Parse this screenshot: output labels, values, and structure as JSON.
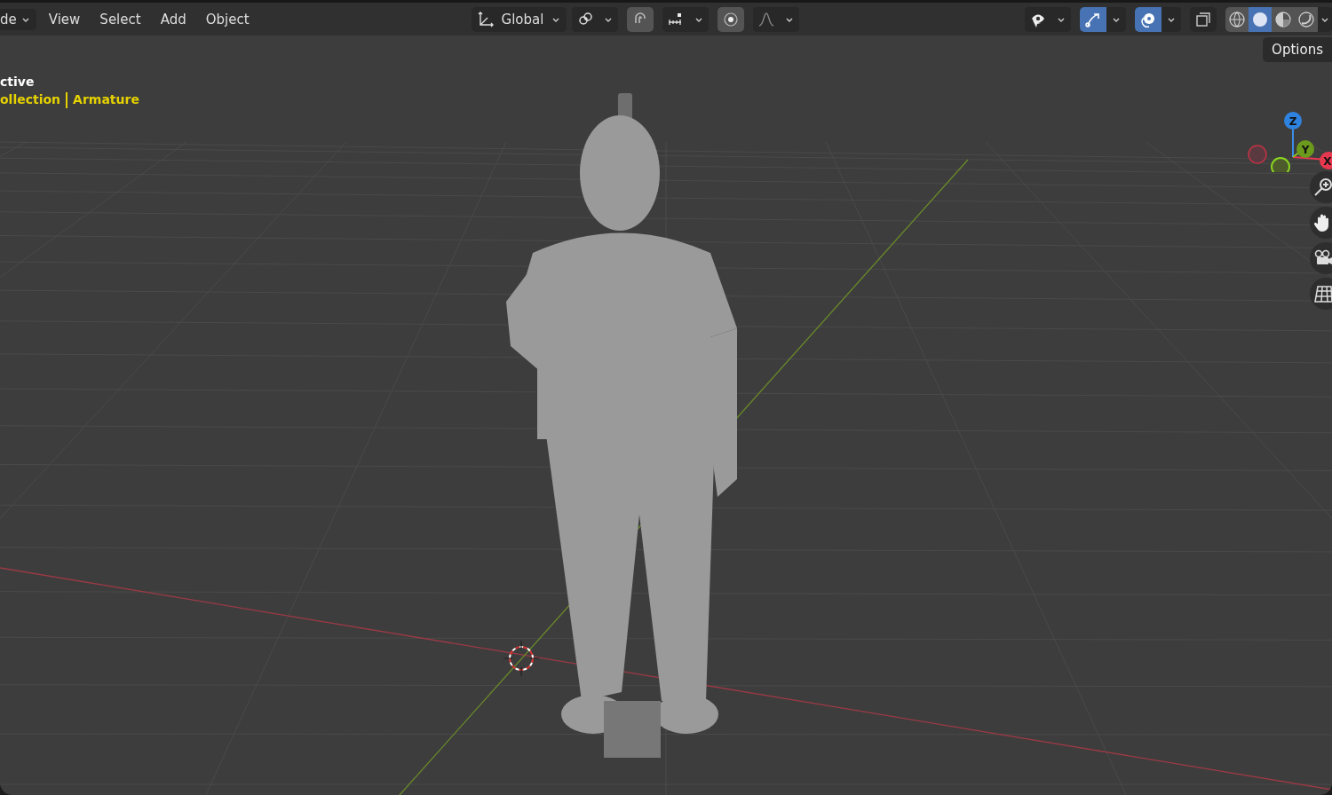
{
  "header": {
    "mode_dropdown": "de",
    "menus": [
      "View",
      "Select",
      "Add",
      "Object"
    ],
    "transform_orientation": "Global",
    "tools": [
      {
        "kind": "pivot",
        "on": false,
        "dropdown": true
      },
      {
        "kind": "snap",
        "on": true,
        "dropdown": false
      },
      {
        "kind": "increment",
        "on": false,
        "dropdown": true
      },
      {
        "kind": "proportional",
        "on": true,
        "dropdown": false
      },
      {
        "kind": "falloff",
        "on": false,
        "dropdown": true
      }
    ],
    "view_tools": [
      {
        "kind": "visibility",
        "on": false,
        "dropdown": true
      },
      {
        "kind": "gizmo",
        "on": true,
        "dropdown": true
      },
      {
        "kind": "overlay",
        "on": true,
        "dropdown": true
      },
      {
        "kind": "xray",
        "on": false,
        "dropdown": false
      }
    ],
    "shading_modes": [
      {
        "kind": "wireframe",
        "selected": false
      },
      {
        "kind": "solid",
        "selected": true
      },
      {
        "kind": "material",
        "selected": false
      },
      {
        "kind": "rendered",
        "selected": false
      }
    ]
  },
  "viewport": {
    "view_name": "ctive",
    "collection": "ollection",
    "object": "Armature",
    "options_button": "Options",
    "axes": [
      "Z",
      "Y",
      "X"
    ]
  }
}
